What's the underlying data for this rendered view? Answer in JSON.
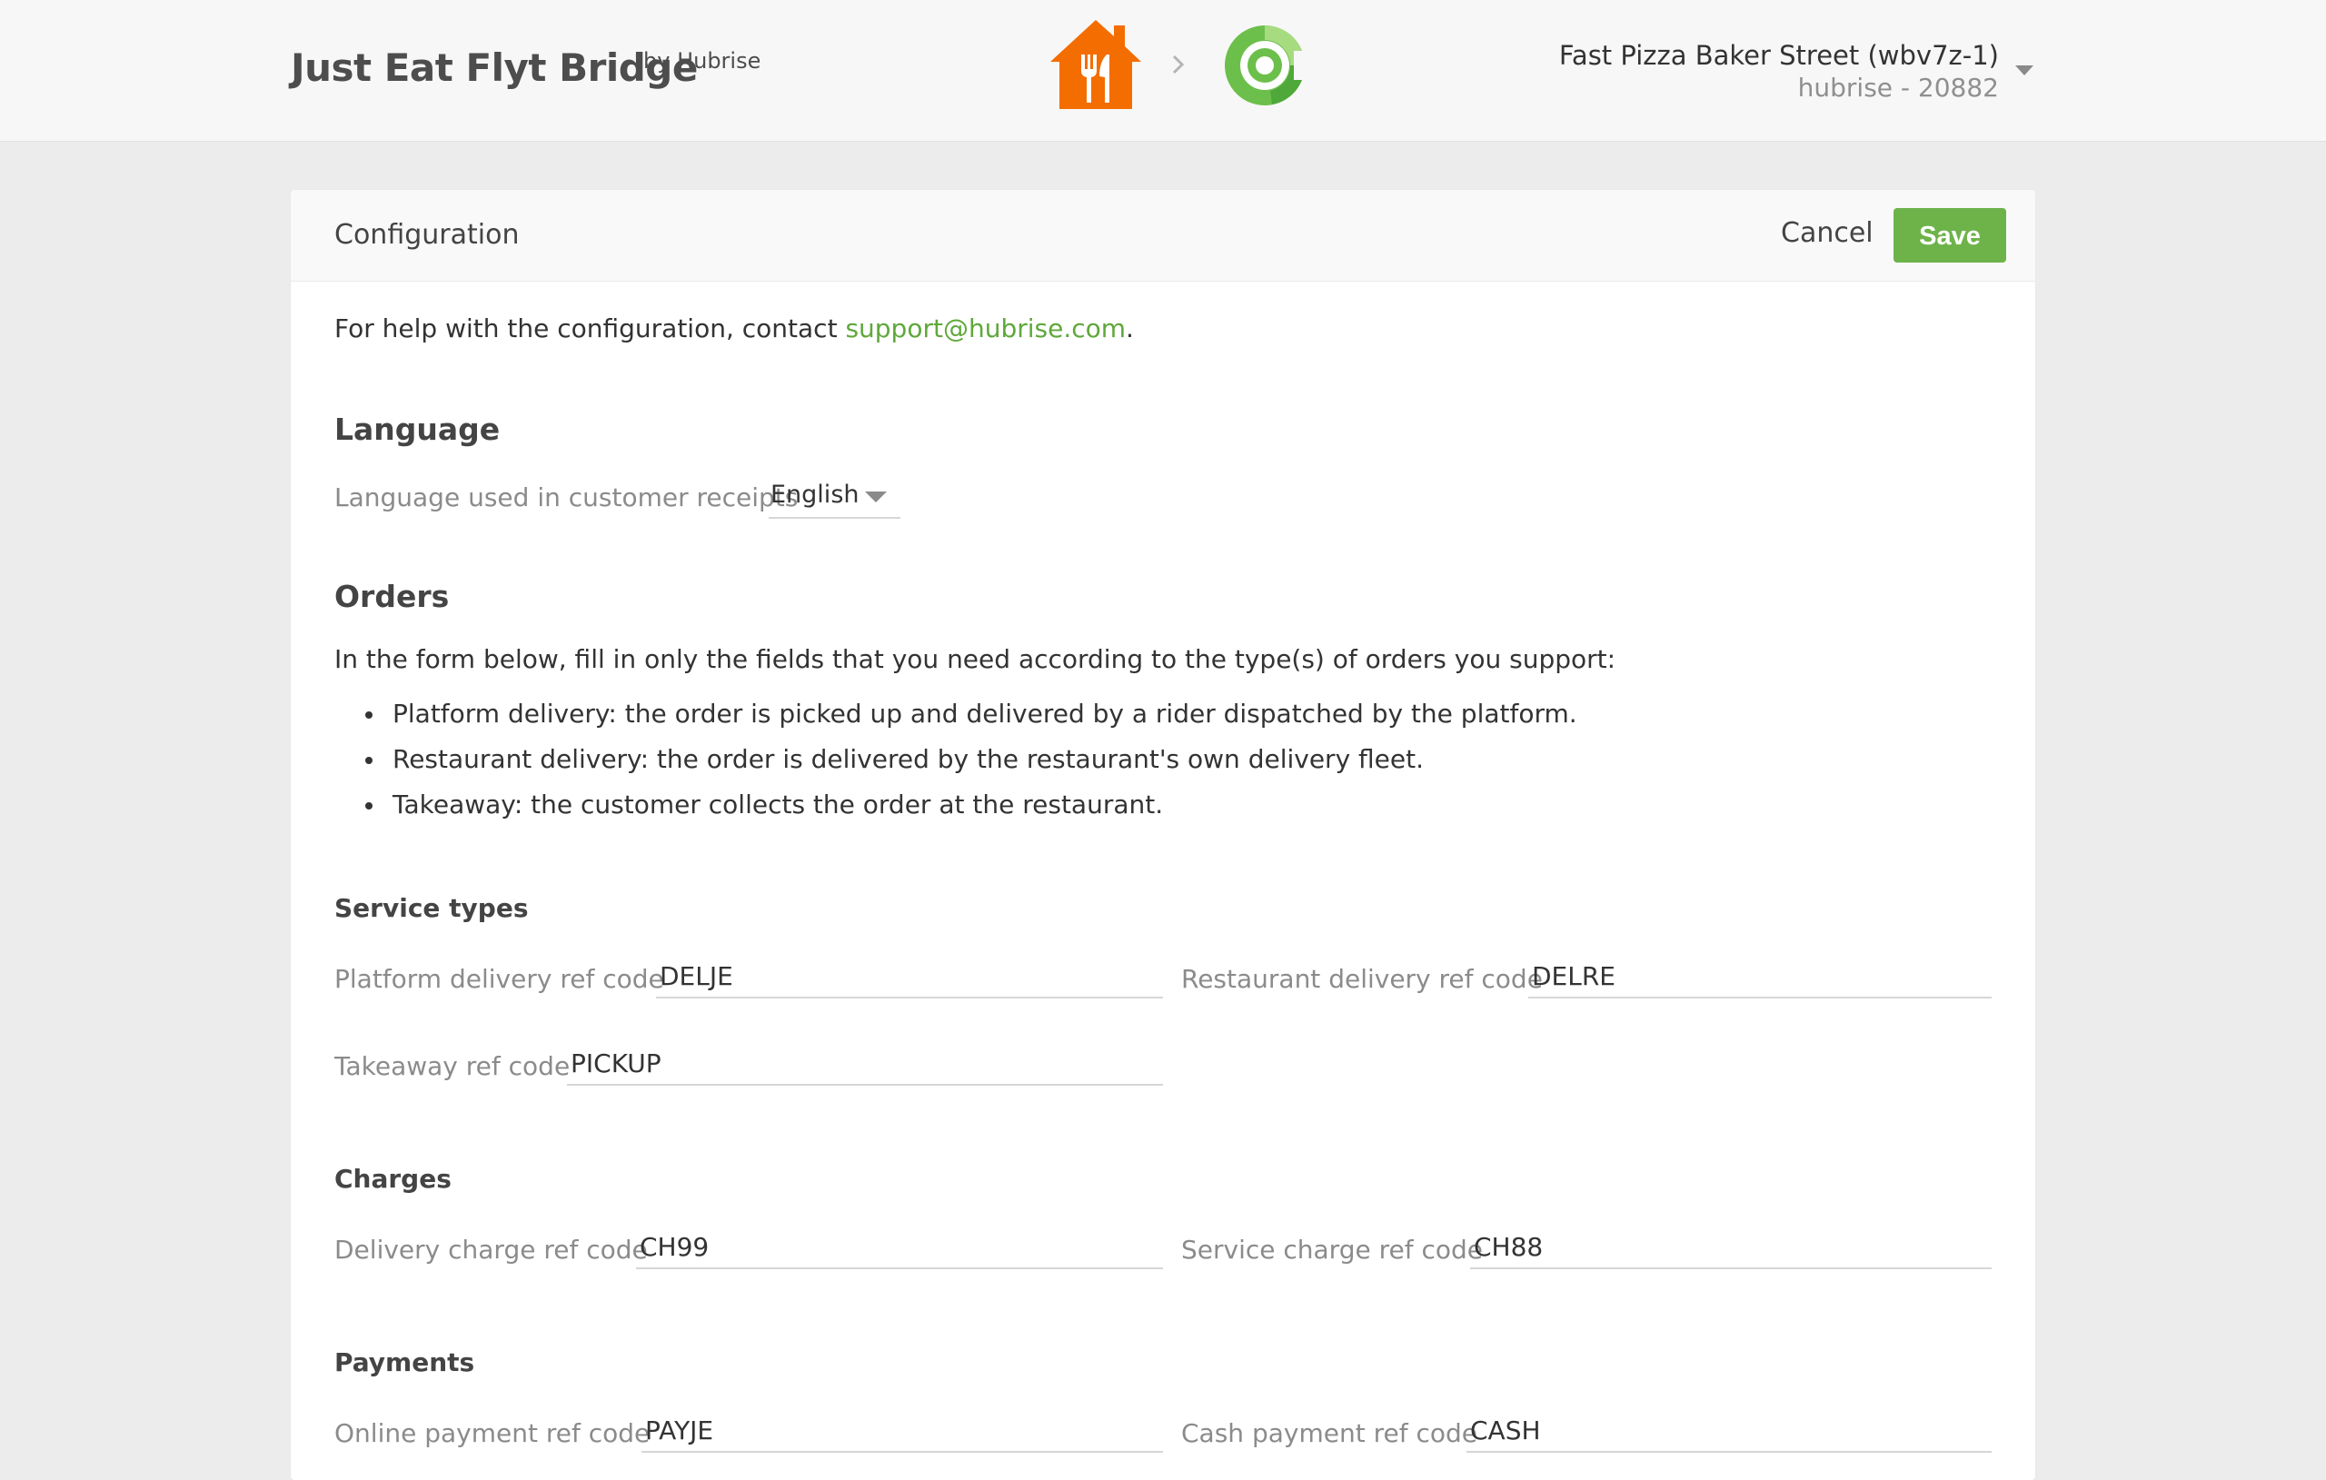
{
  "header": {
    "app_title": "Just Eat Flyt Bridge",
    "app_byline": "by Hubrise",
    "account_name": "Fast Pizza Baker Street (wbv7z-1)",
    "account_sub": "hubrise - 20882"
  },
  "colors": {
    "accent": "#6db34a",
    "link": "#5fa83a",
    "just_eat_orange": "#f36d00",
    "hubrise_green": "#6cbf4b"
  },
  "icons": {
    "source_logo": "just-eat-logo",
    "flow_arrow": "chevron-right-icon",
    "target_logo": "hubrise-logo",
    "account_menu": "caret-down-icon"
  },
  "card": {
    "title": "Configuration",
    "cancel_label": "Cancel",
    "save_label": "Save"
  },
  "help": {
    "prefix": "For help with the configuration, contact ",
    "email": "support@hubrise.com",
    "suffix": "."
  },
  "language": {
    "heading": "Language",
    "label": "Language used in customer receipts",
    "selected": "English"
  },
  "orders": {
    "heading": "Orders",
    "intro": "In the form below, fill in only the fields that you need according to the type(s) of orders you support:",
    "bullets": [
      "Platform delivery: the order is picked up and delivered by a rider dispatched by the platform.",
      "Restaurant delivery: the order is delivered by the restaurant's own delivery fleet.",
      "Takeaway: the customer collects the order at the restaurant."
    ]
  },
  "service_types": {
    "heading": "Service types",
    "platform_delivery_label": "Platform delivery ref code",
    "platform_delivery_value": "DELJE",
    "restaurant_delivery_label": "Restaurant delivery ref code",
    "restaurant_delivery_value": "DELRE",
    "takeaway_label": "Takeaway ref code",
    "takeaway_value": "PICKUP"
  },
  "charges": {
    "heading": "Charges",
    "delivery_charge_label": "Delivery charge ref code",
    "delivery_charge_value": "CH99",
    "service_charge_label": "Service charge ref code",
    "service_charge_value": "CH88"
  },
  "payments": {
    "heading": "Payments",
    "online_payment_label": "Online payment ref code",
    "online_payment_value": "PAYJE",
    "cash_payment_label": "Cash payment ref code",
    "cash_payment_value": "CASH"
  }
}
